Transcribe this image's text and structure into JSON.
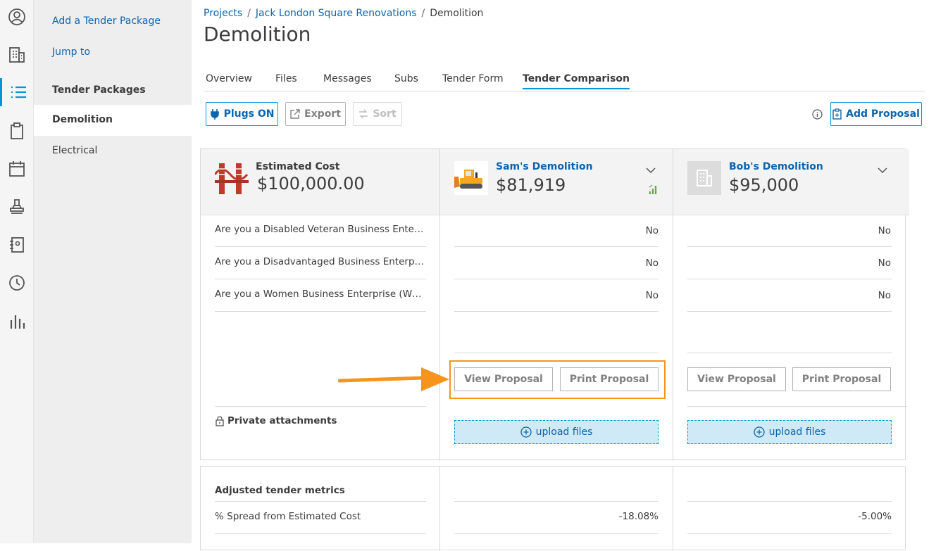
{
  "rail": {
    "icons": [
      "user-icon",
      "building-icon",
      "list-icon",
      "clipboard-icon",
      "calendar-icon",
      "stamp-icon",
      "address-book-icon",
      "clock-icon",
      "bar-chart-icon"
    ],
    "active": "list-icon"
  },
  "sidebar": {
    "add_link": "Add a Tender Package",
    "jump_link": "Jump to",
    "heading": "Tender Packages",
    "items": [
      {
        "label": "Demolition"
      },
      {
        "label": "Electrical"
      }
    ]
  },
  "breadcrumb": {
    "projects": "Projects",
    "sep1": "/",
    "project": "Jack London Square Renovations",
    "sep2": "/",
    "current": "Demolition"
  },
  "page": {
    "title": "Demolition"
  },
  "tabs": [
    "Overview",
    "Files",
    "Messages",
    "Subs",
    "Tender Form",
    "Tender Comparison"
  ],
  "toolbar": {
    "plugs": "Plugs ON",
    "export": "Export",
    "sort": "Sort",
    "add_proposal": "Add Proposal"
  },
  "estimate": {
    "label": "Estimated Cost",
    "value": "$100,000.00"
  },
  "bidders": [
    {
      "name": "Sam's Demolition",
      "price": "$81,919"
    },
    {
      "name": "Bob's Demolition",
      "price": "$95,000"
    }
  ],
  "questions": [
    "Are you a Disabled Veteran Business Enterprise (DVBE)?",
    "Are you a Disadvantaged Business Enterprise (DBE)?",
    "Are you a Women Business Enterprise (WBE)?"
  ],
  "answers": [
    [
      "No",
      "No",
      "No"
    ],
    [
      "No",
      "No",
      "No"
    ]
  ],
  "proposal_actions": {
    "view": "View Proposal",
    "print": "Print Proposal"
  },
  "attachments": {
    "label": "Private attachments",
    "upload": "upload files"
  },
  "metrics": {
    "heading": "Adjusted tender metrics",
    "spread_label": "% Spread from Estimated Cost",
    "spread_values": [
      "-18.08%",
      "-5.00%"
    ]
  },
  "colors": {
    "accent": "#0696d7",
    "link": "#0b64b0",
    "highlight": "#f7941d",
    "upload_bg": "#cfe9f6"
  }
}
